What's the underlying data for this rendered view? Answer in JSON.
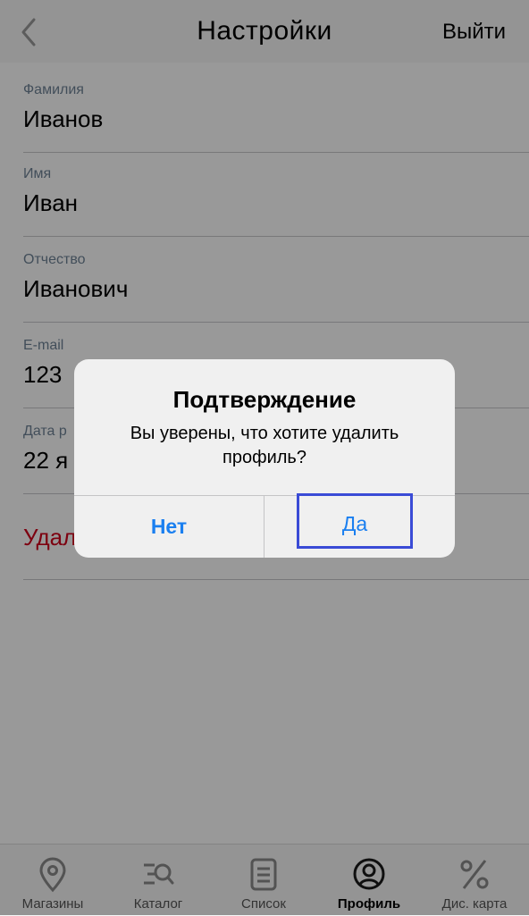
{
  "header": {
    "title": "Настройки",
    "logout_label": "Выйти"
  },
  "form": {
    "fields": [
      {
        "label": "Фамилия",
        "value": "Иванов"
      },
      {
        "label": "Имя",
        "value": "Иван"
      },
      {
        "label": "Отчество",
        "value": "Иванович"
      },
      {
        "label": "E-mail",
        "value": "123 "
      },
      {
        "label": "Дата р",
        "value": "22 я"
      }
    ],
    "delete_label": "Удал"
  },
  "dialog": {
    "title": "Подтверждение",
    "message": "Вы уверены, что хотите удалить профиль?",
    "no_label": "Нет",
    "yes_label": "Да"
  },
  "tabbar": {
    "tabs": [
      {
        "label": "Магазины",
        "icon": "map-pin-icon"
      },
      {
        "label": "Каталог",
        "icon": "catalog-search-icon"
      },
      {
        "label": "Список",
        "icon": "list-icon"
      },
      {
        "label": "Профиль",
        "icon": "profile-icon"
      },
      {
        "label": "Дис. карта",
        "icon": "percent-icon"
      }
    ]
  },
  "colors": {
    "accent": "#1a7ff0",
    "delete": "#d0021b",
    "label": "#6f8396",
    "focus_border": "#3a4bd6"
  }
}
